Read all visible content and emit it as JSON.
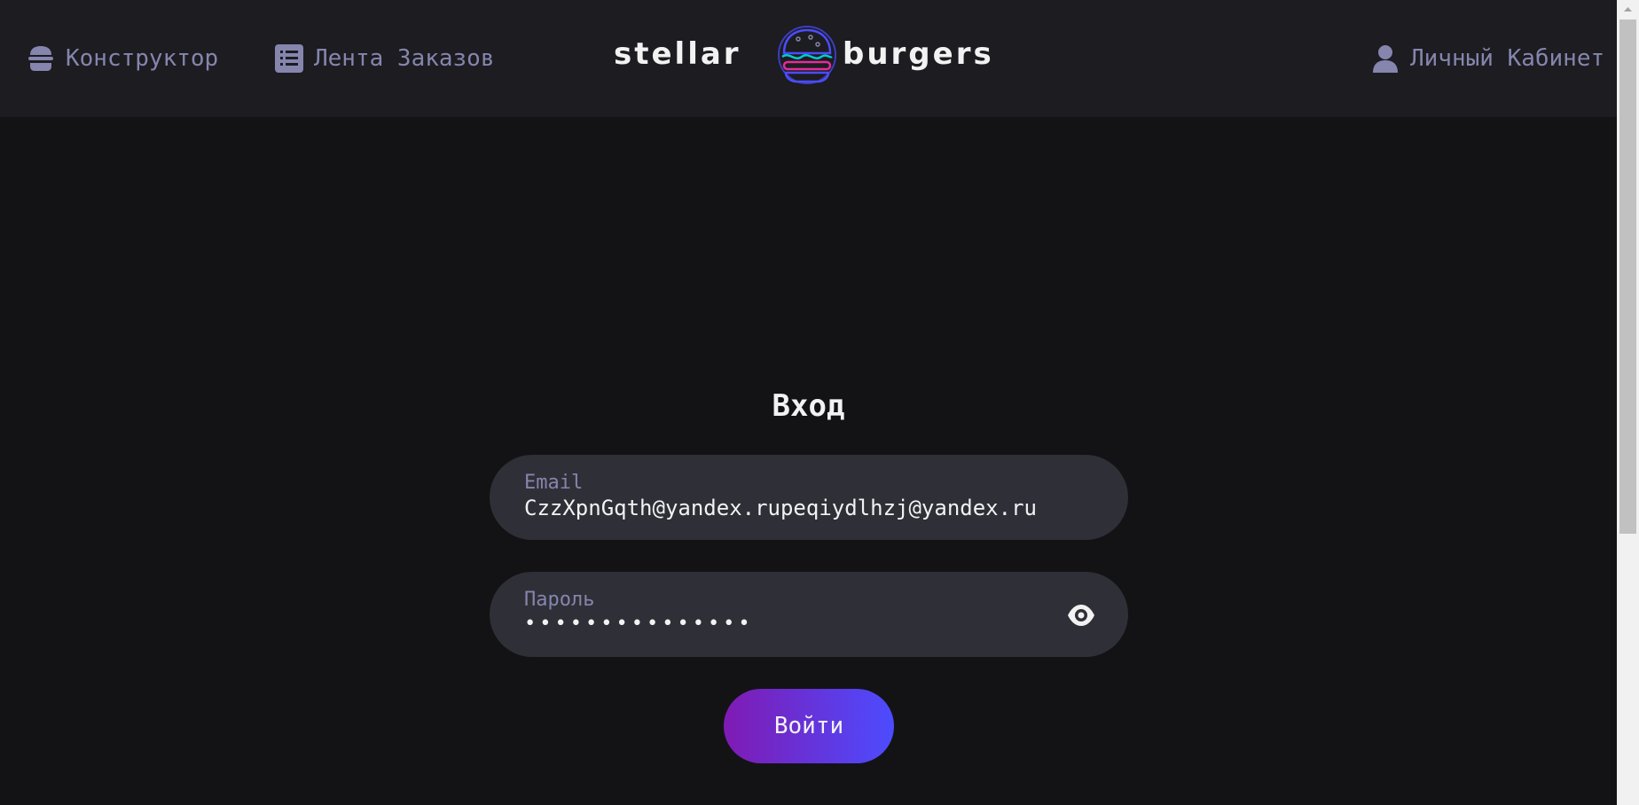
{
  "header": {
    "nav": {
      "constructor_label": "Конструктор",
      "feed_label": "Лента Заказов",
      "account_label": "Личный Кабинет"
    },
    "logo": {
      "left_text": "stellar",
      "right_text": "burgers"
    }
  },
  "login": {
    "title": "Вход",
    "email": {
      "label": "Email",
      "value": "CzzXpnGqth@yandex.rupeqiydlhzj@yandex.ru"
    },
    "password": {
      "label": "Пароль",
      "value": "•••••••••••••••"
    },
    "submit_label": "Войти"
  },
  "colors": {
    "background": "#131316",
    "header": "#1c1c21",
    "field": "#2f2f37",
    "muted_text": "#8585ad",
    "primary_text": "#f2f2f3",
    "button_gradient_start": "#801ab3",
    "button_gradient_end": "#4c4cff"
  },
  "icons": {
    "constructor": "burger-icon",
    "feed": "list-icon",
    "account": "profile-icon",
    "password_toggle": "eye-icon"
  }
}
